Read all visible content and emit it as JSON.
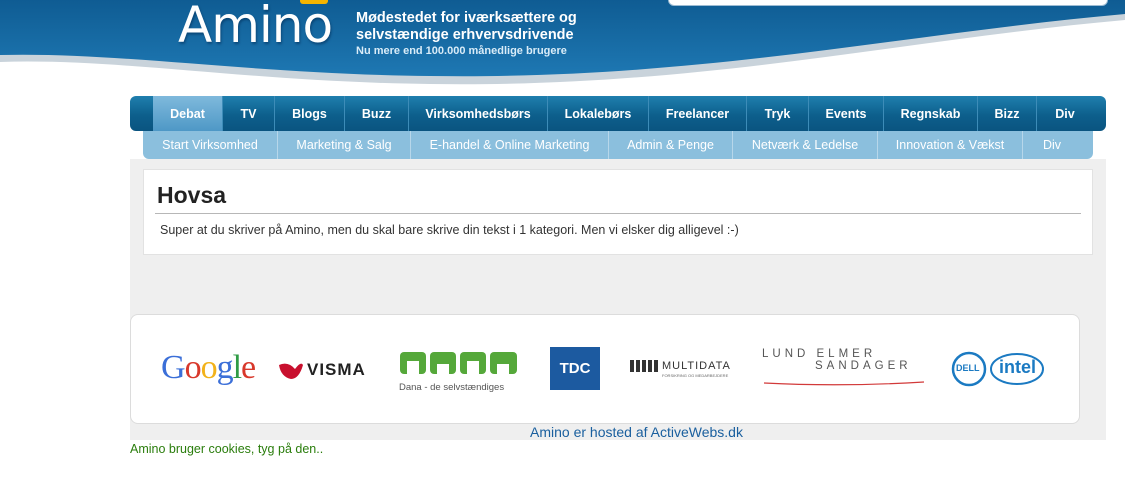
{
  "header": {
    "logo_text": "Amino",
    "tagline_line1": "Mødestedet for iværksættere og",
    "tagline_line2": "selvstændige erhvervsdrivende",
    "tagline_line3": "Nu mere end 100.000 månedlige brugere"
  },
  "main_nav": {
    "tabs": [
      {
        "label": "Debat",
        "active": true
      },
      {
        "label": "TV"
      },
      {
        "label": "Blogs"
      },
      {
        "label": "Buzz"
      },
      {
        "label": "Virksomhedsbørs"
      },
      {
        "label": "Lokalebørs"
      },
      {
        "label": "Freelancer"
      },
      {
        "label": "Tryk"
      },
      {
        "label": "Events"
      },
      {
        "label": "Regnskab"
      },
      {
        "label": "Bizz"
      },
      {
        "label": "Div"
      }
    ]
  },
  "sub_nav": {
    "items": [
      {
        "label": "Start Virksomhed"
      },
      {
        "label": "Marketing & Salg"
      },
      {
        "label": "E-handel & Online Marketing"
      },
      {
        "label": "Admin & Penge"
      },
      {
        "label": "Netværk & Ledelse"
      },
      {
        "label": "Innovation & Vækst"
      },
      {
        "label": "Div"
      }
    ]
  },
  "message": {
    "title": "Hovsa",
    "text": "Super at du skriver på Amino, men du skal bare skrive din tekst i 1 kategori. Men vi elsker dig alligevel :-)"
  },
  "sponsors": {
    "google": "Google",
    "visma": "VISMA",
    "dana_caption": "Dana - de selvstændiges",
    "tdc": "TDC",
    "multidata": "MULTIDATA",
    "multidata_sub": "FORSIKRING OG MEDARBEJDERE",
    "lund_line1": "LUND ELMER",
    "lund_line2": "SANDAGER",
    "dell": "DELL",
    "intel": "intel"
  },
  "footer": {
    "hosted": "Amino er hosted af ActiveWebs.dk",
    "cookie": "Amino bruger cookies, tyg på den.."
  },
  "colors": {
    "header_blue": "#1565a0",
    "nav_blue": "#0d5f8c",
    "subnav_blue": "#8bbfdd",
    "link_blue": "#1a5f9e",
    "cookie_green": "#2a7d0c"
  }
}
